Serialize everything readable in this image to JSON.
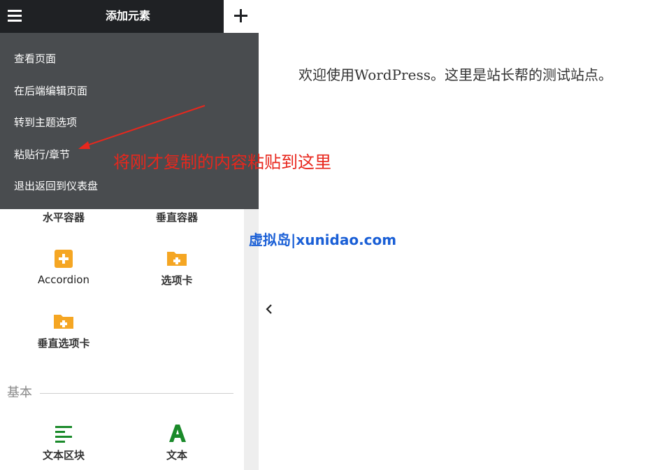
{
  "header": {
    "title": "添加元素",
    "menu_icon": "hamburger-icon",
    "add_icon": "plus-icon"
  },
  "dropdown": {
    "items": [
      {
        "label": "查看页面"
      },
      {
        "label": "在后端编辑页面"
      },
      {
        "label": "转到主题选项"
      },
      {
        "label": "粘贴行/章节"
      },
      {
        "label": "退出返回到仪表盘"
      }
    ]
  },
  "widgets": {
    "row1": [
      "水平容器",
      "垂直容器"
    ],
    "accordion": "Accordion",
    "tabs": "选项卡",
    "vertical_tabs": "垂直选项卡",
    "basic_section": "基本",
    "text_block": "文本区块",
    "text": "文本"
  },
  "content": {
    "welcome": "欢迎使用WordPress。这里是站长帮的测试站点。",
    "annotation": "将刚才复制的内容粘贴到这里",
    "watermark": "虚拟岛|xunidao.com"
  },
  "colors": {
    "topbar": "#1f2124",
    "dropdown": "#494c4f",
    "widget_icon": "#f5a623",
    "text_icon": "#1a8a2a",
    "annotation": "#e8271d",
    "watermark": "#1a5fd6"
  }
}
